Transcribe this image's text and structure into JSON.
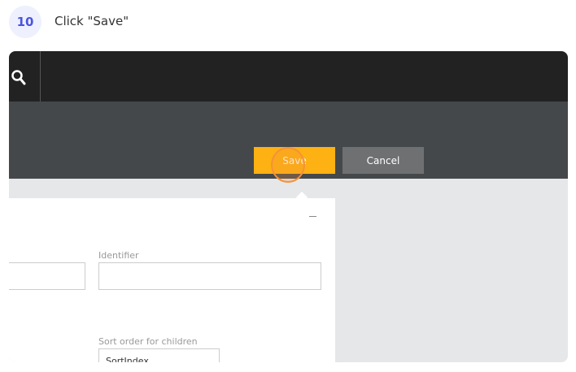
{
  "step": {
    "number": "10",
    "instruction": "Click \"Save\""
  },
  "toolbar": {
    "save_label": "Save",
    "cancel_label": "Cancel"
  },
  "form": {
    "identifier_label": "Identifier",
    "identifier_value": "",
    "sort_label": "Sort order for children",
    "sort_value": "SortIndex"
  },
  "colors": {
    "accent": "#fdb112",
    "cancel": "#6f7072",
    "header": "#222222"
  }
}
